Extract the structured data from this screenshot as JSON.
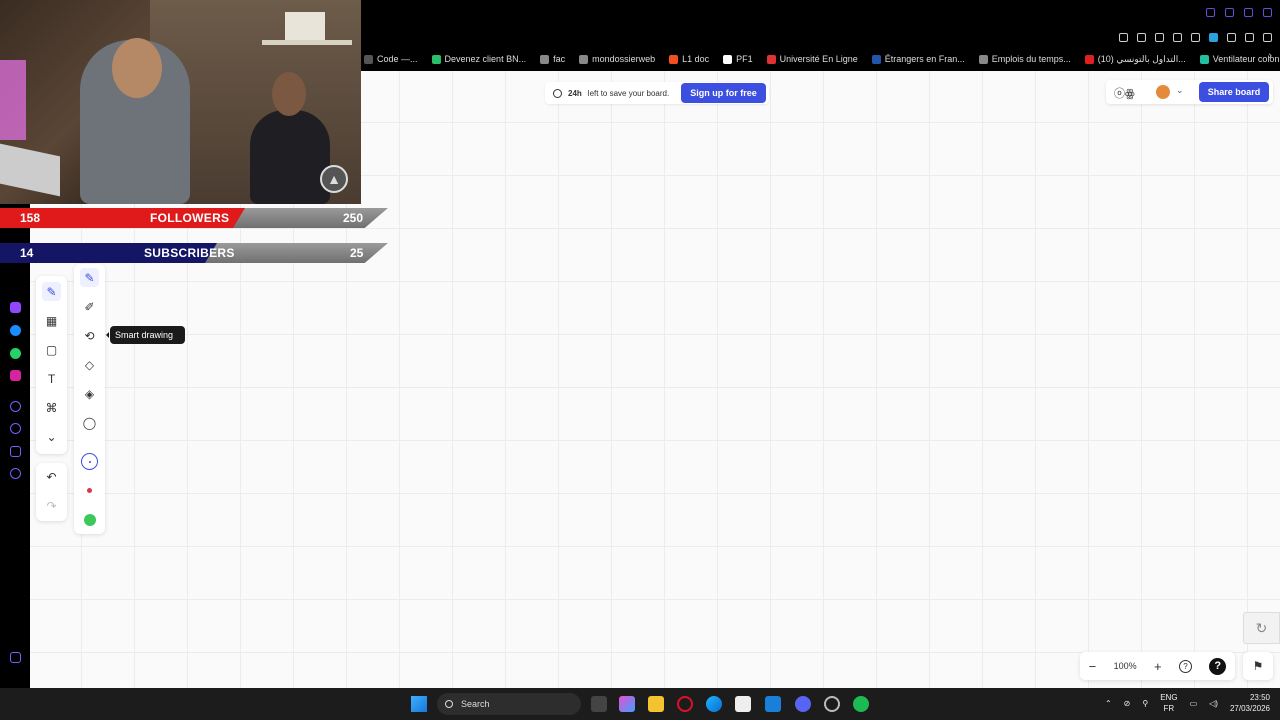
{
  "bookmarks": [
    {
      "label": "Code —...",
      "color": "#555"
    },
    {
      "label": "Devenez client BN...",
      "color": "#2bbf6d"
    },
    {
      "label": "fac",
      "color": "#888"
    },
    {
      "label": "mondossierweb",
      "color": "#888"
    },
    {
      "label": "L1 doc",
      "color": "#f25022"
    },
    {
      "label": "PF1",
      "color": "#fff"
    },
    {
      "label": "Université En Ligne",
      "color": "#d33"
    },
    {
      "label": "Étrangers en Fran...",
      "color": "#2255aa"
    },
    {
      "label": "Emplois du temps...",
      "color": "#888"
    },
    {
      "label": "(10) التداول بالتونسي...",
      "color": "#e02020"
    },
    {
      "label": "Ventilateur colonn...",
      "color": "#20c0a0"
    }
  ],
  "overlay": {
    "followers": {
      "current": "158",
      "label": "FOLLOWERS",
      "goal": "250",
      "progress": 0.632,
      "color": "#e01a1a"
    },
    "subscribers": {
      "current": "14",
      "label": "SUBSCRIBERS",
      "goal": "25",
      "progress": 0.56,
      "color": "#151566"
    }
  },
  "banner": {
    "bold": "24h",
    "text": "left to save your board.",
    "signup_label": "Sign up for free"
  },
  "header": {
    "collab_icon_text": "ⓞꙮ",
    "share_label": "Share board"
  },
  "tooltip": {
    "text": "Smart drawing"
  },
  "zoom": {
    "level": "100%",
    "minus": "−",
    "plus": "+",
    "help": "?",
    "help_dark": "?"
  },
  "taskbar": {
    "search_label": "Search",
    "lang_top": "ENG",
    "lang_bottom": "FR",
    "time": "23:50",
    "date": "27/03/2026"
  },
  "accent": "#3c4fe0",
  "pen_colors": [
    "#3c4fe0",
    "#e0344d",
    "#3cc85a"
  ]
}
